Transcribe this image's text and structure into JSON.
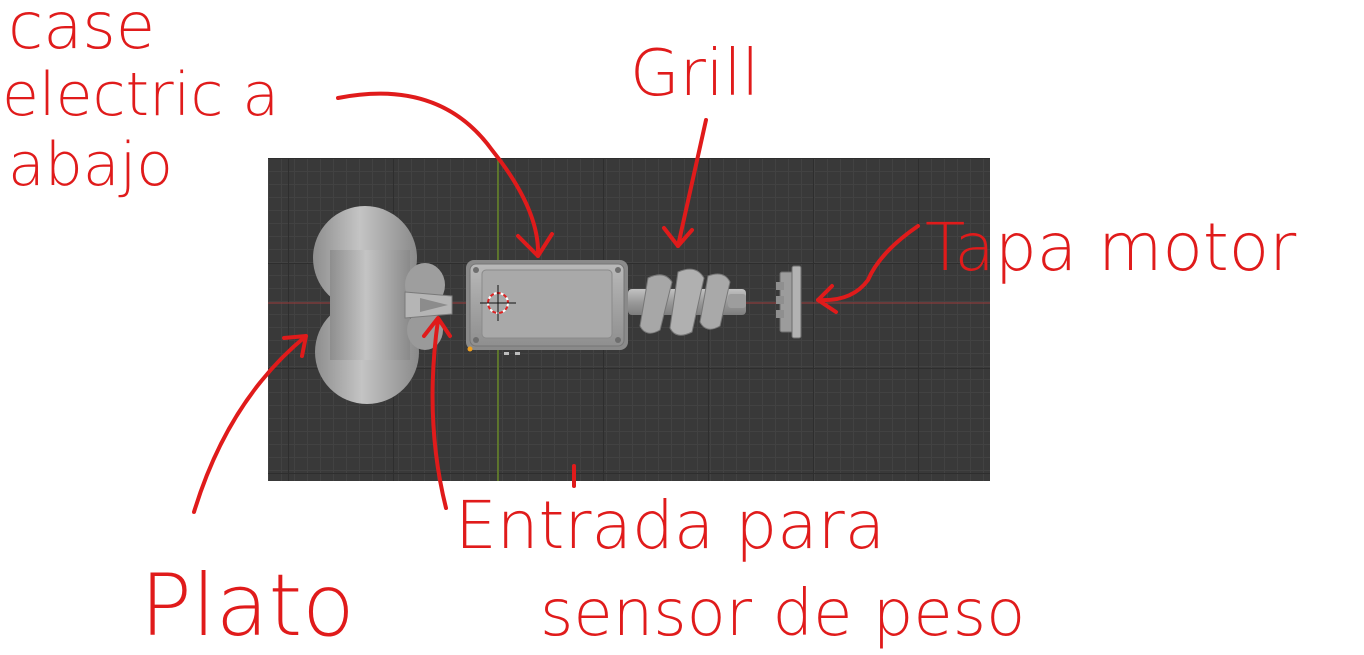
{
  "annotations": {
    "case_line1": "case",
    "case_line2": "electric a",
    "case_line3": "abajo",
    "grill": "Grill",
    "tapa_motor": "Tapa motor",
    "plato": "Plato",
    "entrada_line1": "Entrada para",
    "entrada_line2": "sensor de peso"
  },
  "colors": {
    "ink": "#e01b1b",
    "viewport_bg": "#393939",
    "model_gray": "#a8a8a8",
    "x_axis": "#9a3b3b",
    "y_axis": "#6a8a2a"
  }
}
